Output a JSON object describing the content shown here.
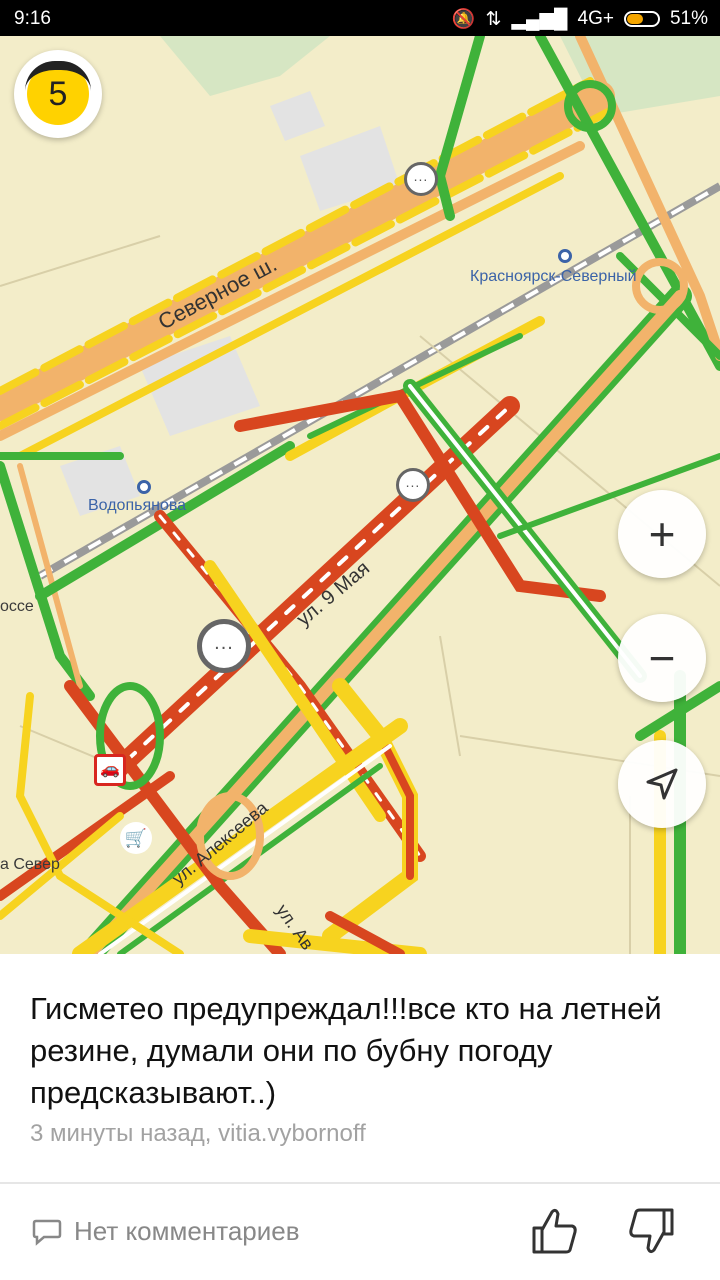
{
  "status_bar": {
    "time": "9:16",
    "network": "4G+",
    "battery": "51%"
  },
  "map": {
    "traffic_score": "5",
    "labels": {
      "severnoe": "Северное ш.",
      "krasnoyarsk_severny": "Красноярск-Северный",
      "vodopyanova": "Водопьянова",
      "ul_9_maya": "ул. 9 Мая",
      "ul_alekseeva": "ул. Алексеева",
      "ul_av": "ул. Ав",
      "osse": "оссе",
      "a_sever": "а Север"
    }
  },
  "controls": {
    "zoom_in": "+",
    "zoom_out": "−"
  },
  "card": {
    "message": "Гисметео предупреждал!!!все кто на летней резине, думали они по бубну погоду предсказывают..)",
    "meta": "3 минуты назад, vitia.vybornoff",
    "comments": "Нет комментариев"
  }
}
